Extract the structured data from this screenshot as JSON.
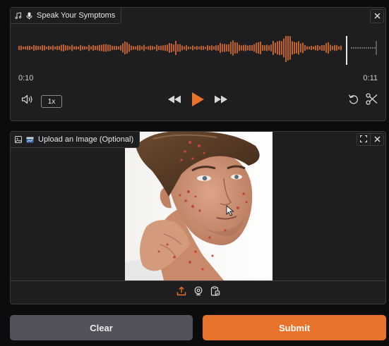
{
  "audio": {
    "label": "Speak Your Symptoms",
    "time_current": "0:10",
    "time_total": "0:11",
    "playback_rate": "1x",
    "progress": 0.91
  },
  "image_upload": {
    "label": "Upload an Image (Optional)"
  },
  "actions": {
    "clear_label": "Clear",
    "submit_label": "Submit"
  },
  "colors": {
    "accent": "#e8732a",
    "panel_bg": "#1e1e20",
    "border": "#3a3a3d",
    "clear_bg": "#52525a"
  },
  "icons": [
    "music-note-icon",
    "microphone-icon",
    "close-icon",
    "volume-icon",
    "rewind-icon",
    "play-icon",
    "fast-forward-icon",
    "undo-icon",
    "scissors-icon",
    "image-icon",
    "upload-icon",
    "webcam-icon",
    "clipboard-icon",
    "fullscreen-icon"
  ]
}
